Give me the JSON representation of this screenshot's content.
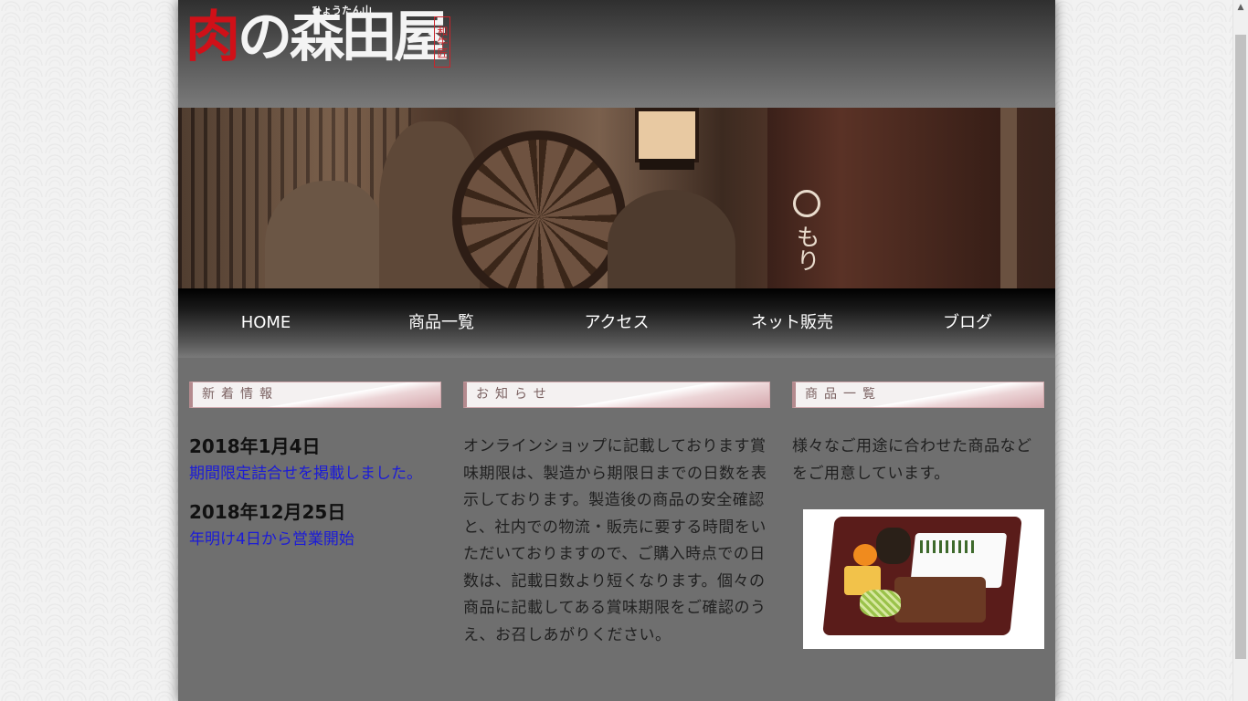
{
  "header": {
    "logo_red": "肉",
    "logo_main": "の森田屋",
    "logo_ruby": "ひょうたん山",
    "logo_stamp": "和牛匠"
  },
  "hero": {
    "noren_text": "もり"
  },
  "nav": {
    "items": [
      {
        "label": "HOME"
      },
      {
        "label": "商品一覧"
      },
      {
        "label": "アクセス"
      },
      {
        "label": "ネット販売"
      },
      {
        "label": "ブログ"
      }
    ]
  },
  "news": {
    "heading": "新着情報",
    "entries": [
      {
        "date": "2018年1月4日",
        "text": "期間限定詰合せを掲載しました。"
      },
      {
        "date": "2018年12月25日",
        "text": "年明け4日から営業開始"
      }
    ]
  },
  "notice": {
    "heading": "お知らせ",
    "body": "オンラインショップに記載しております賞味期限は、製造から期限日までの日数を表示しております。製造後の商品の安全確認と、社内での物流・販売に要する時間をいただいておりますので、ご購入時点での日数は、記載日数より短くなります。個々の商品に記載してある賞味期限をご確認のうえ、お召しあがりください。"
  },
  "products": {
    "heading": "商品一覧",
    "body": "様々なご用途に合わせた商品などをご用意しています。",
    "image": "bento-box-image"
  },
  "colors": {
    "logo_red": "#d01018",
    "link_blue": "#1b1bd8",
    "nav_text": "#ffffff",
    "section_head_text": "#7b6262"
  },
  "icons": {
    "scroll_up": "triangle-up-icon"
  }
}
